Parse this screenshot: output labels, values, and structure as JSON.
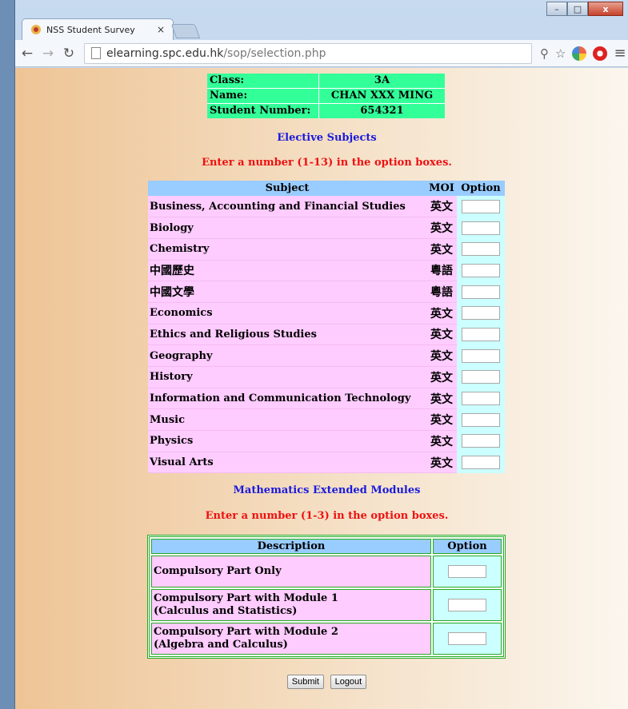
{
  "browser": {
    "tab_title": "NSS Student Survey",
    "tab_close": "×",
    "url_host": "elearning.spc.edu.hk",
    "url_path": "/sop/selection.php",
    "window_controls": [
      "–",
      "□",
      "x"
    ]
  },
  "student": {
    "class_label": "Class:",
    "class_value": "3A",
    "name_label": "Name:",
    "name_value": "CHAN XXX MING",
    "number_label": "Student Number:",
    "number_value": "654321"
  },
  "electives": {
    "heading": "Elective Subjects",
    "instruction": "Enter a number (1-13) in the option boxes.",
    "col_subject": "Subject",
    "col_moi": "MOI",
    "col_option": "Option",
    "rows": [
      {
        "subject": "Business, Accounting and Financial Studies",
        "moi": "英文",
        "option": ""
      },
      {
        "subject": "Biology",
        "moi": "英文",
        "option": ""
      },
      {
        "subject": "Chemistry",
        "moi": "英文",
        "option": ""
      },
      {
        "subject": "中國歷史",
        "moi": "粵語",
        "option": ""
      },
      {
        "subject": "中國文學",
        "moi": "粵語",
        "option": ""
      },
      {
        "subject": "Economics",
        "moi": "英文",
        "option": ""
      },
      {
        "subject": "Ethics and Religious Studies",
        "moi": "英文",
        "option": ""
      },
      {
        "subject": "Geography",
        "moi": "英文",
        "option": ""
      },
      {
        "subject": "History",
        "moi": "英文",
        "option": ""
      },
      {
        "subject": "Information and Communication Technology",
        "moi": "英文",
        "option": ""
      },
      {
        "subject": "Music",
        "moi": "英文",
        "option": ""
      },
      {
        "subject": "Physics",
        "moi": "英文",
        "option": ""
      },
      {
        "subject": "Visual Arts",
        "moi": "英文",
        "option": ""
      }
    ]
  },
  "maths": {
    "heading": "Mathematics Extended Modules",
    "instruction": "Enter a number (1-3) in the option boxes.",
    "col_description": "Description",
    "col_option": "Option",
    "rows": [
      {
        "line1": "Compulsory Part Only",
        "line2": "",
        "option": ""
      },
      {
        "line1": "Compulsory Part with Module 1",
        "line2": "(Calculus and Statistics)",
        "option": ""
      },
      {
        "line1": "Compulsory Part with Module 2",
        "line2": "(Algebra and Calculus)",
        "option": ""
      }
    ]
  },
  "actions": {
    "submit": "Submit",
    "logout": "Logout"
  },
  "colors": {
    "info_bg": "#33ff99",
    "header_bg": "#99ccff",
    "subject_bg": "#ffccff",
    "option_bg": "#ccffff",
    "heading_blue": "#1a1add",
    "heading_red": "#ee1111"
  }
}
